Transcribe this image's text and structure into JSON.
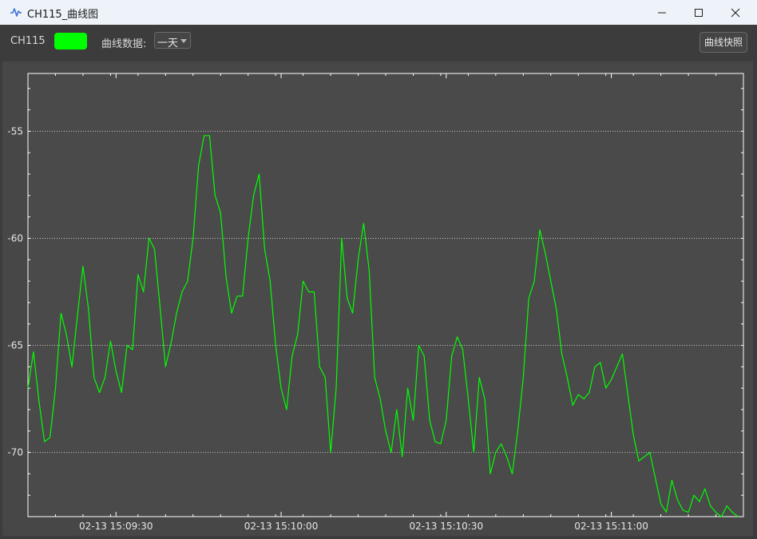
{
  "window": {
    "title": "CH115_曲线图",
    "controls": [
      "minimize-icon",
      "maximize-icon",
      "close-icon"
    ]
  },
  "toolbar": {
    "channel_label": "CH115",
    "swatch_color": "#00ff00",
    "data_label": "曲线数据:",
    "range_value": "一天",
    "snapshot_label": "曲线快照"
  },
  "colors": {
    "line": "#00ff00",
    "plot_bg": "#4a4a4a",
    "grid": "#c8c8c8",
    "axis": "#ffffff"
  },
  "chart_data": {
    "type": "line",
    "title": "",
    "xlabel": "",
    "ylabel": "",
    "ylim": [
      -73,
      -52.3
    ],
    "yticks": [
      -55,
      -60,
      -65,
      -70
    ],
    "xlim": [
      "02-13 15:09:14",
      "02-13 15:11:24"
    ],
    "xticks": [
      "02-13 15:09:30",
      "02-13 15:10:00",
      "02-13 15:10:30",
      "02-13 15:11:00"
    ],
    "grid": "horizontal dotted",
    "series": [
      {
        "color": "#00ff00",
        "x_seconds_from_15_09_14": [
          0,
          1,
          2,
          3,
          4,
          5,
          6,
          7,
          8,
          9,
          10,
          11,
          12,
          13,
          14,
          15,
          16,
          17,
          18,
          19,
          20,
          21,
          22,
          23,
          24,
          25,
          26,
          27,
          28,
          29,
          30,
          31,
          32,
          33,
          34,
          35,
          36,
          37,
          38,
          39,
          40,
          41,
          42,
          43,
          44,
          45,
          46,
          47,
          48,
          49,
          50,
          51,
          52,
          53,
          54,
          55,
          56,
          57,
          58,
          59,
          60,
          61,
          62,
          63,
          64,
          65,
          66,
          67,
          68,
          69,
          70,
          71,
          72,
          73,
          74,
          75,
          76,
          77,
          78,
          79,
          80,
          81,
          82,
          83,
          84,
          85,
          86,
          87,
          88,
          89,
          90,
          91,
          92,
          93,
          94,
          95,
          96,
          97,
          98,
          99,
          100,
          101,
          102,
          103,
          104,
          105,
          106,
          107,
          108,
          109,
          110,
          111,
          112,
          113,
          114,
          115,
          116,
          117,
          118,
          119,
          120,
          121,
          122,
          123,
          124,
          125,
          126,
          127,
          128,
          129
        ],
        "values": [
          -67.0,
          -65.3,
          -67.6,
          -69.5,
          -69.3,
          -67.0,
          -63.5,
          -64.5,
          -66.0,
          -63.6,
          -61.3,
          -63.3,
          -66.5,
          -67.2,
          -66.5,
          -64.8,
          -66.2,
          -67.2,
          -65.0,
          -65.2,
          -61.7,
          -62.5,
          -60.0,
          -60.5,
          -63.2,
          -66.0,
          -64.9,
          -63.5,
          -62.5,
          -62.0,
          -60.0,
          -56.6,
          -55.2,
          -55.2,
          -58.0,
          -58.8,
          -61.8,
          -63.5,
          -62.7,
          -62.7,
          -60.0,
          -58.0,
          -57.0,
          -60.5,
          -62.0,
          -65.0,
          -67.0,
          -68.0,
          -65.5,
          -64.5,
          -62.0,
          -62.5,
          -62.5,
          -66.0,
          -66.5,
          -70.0,
          -67.0,
          -60.0,
          -62.8,
          -63.5,
          -61.0,
          -59.3,
          -61.5,
          -66.5,
          -67.5,
          -69.0,
          -70.0,
          -68.0,
          -70.2,
          -67.0,
          -68.5,
          -65.0,
          -65.5,
          -68.5,
          -69.5,
          -69.6,
          -68.5,
          -65.5,
          -64.6,
          -65.2,
          -67.5,
          -70.0,
          -66.5,
          -67.5,
          -71.0,
          -70.0,
          -69.6,
          -70.2,
          -71.0,
          -69.0,
          -66.5,
          -62.8,
          -62.0,
          -59.6,
          -60.7,
          -62.0,
          -63.3,
          -65.4,
          -66.5,
          -67.8,
          -67.3,
          -67.5,
          -67.2,
          -66.0,
          -65.8,
          -67.0,
          -66.6,
          -66.0,
          -65.4,
          -67.3,
          -69.2,
          -70.4,
          -70.2,
          -70.0,
          -71.2,
          -72.4,
          -72.8,
          -71.3,
          -72.2,
          -72.7,
          -72.8,
          -72.0,
          -72.3,
          -71.7,
          -72.5,
          -72.8,
          -73.0,
          -72.5,
          -72.8,
          -73.0
        ],
        "note_removed": true
      }
    ]
  }
}
